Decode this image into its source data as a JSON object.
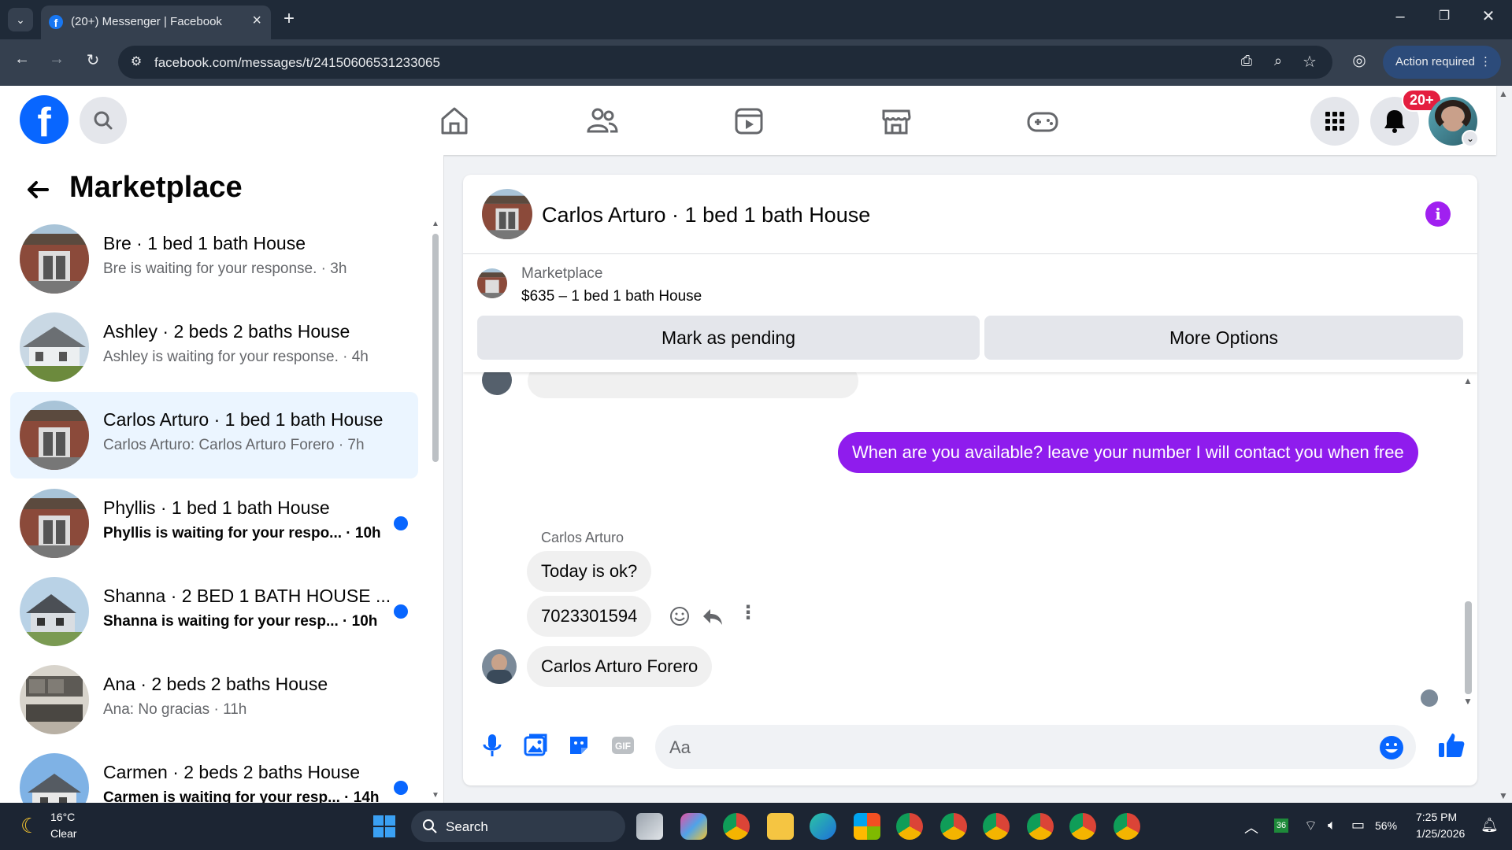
{
  "browser": {
    "tab_title": "(20+) Messenger | Facebook",
    "url": "facebook.com/messages/t/24150606531233065",
    "action_label": "Action required"
  },
  "header": {
    "notification_badge": "20+"
  },
  "sidebar": {
    "title": "Marketplace",
    "conversations": [
      {
        "name": "Bre · 1 bed 1 bath House",
        "preview": "Bre is waiting for your response. · 3h",
        "unread": false,
        "active": false
      },
      {
        "name": "Ashley · 2 beds 2 baths House",
        "preview": "Ashley is waiting for your response. · 4h",
        "unread": false,
        "active": false
      },
      {
        "name": "Carlos Arturo · 1 bed 1 bath House",
        "preview": "Carlos Arturo: Carlos Arturo Forero · 7h",
        "unread": false,
        "active": true
      },
      {
        "name": "Phyllis · 1 bed 1 bath House",
        "preview": "Phyllis is waiting for your respo... · 10h",
        "unread": true,
        "active": false
      },
      {
        "name": "Shanna · 2 BED 1 BATH HOUSE ...",
        "preview": "Shanna is waiting for your resp... · 10h",
        "unread": true,
        "active": false
      },
      {
        "name": "Ana · 2 beds 2 baths House",
        "preview": "Ana: No gracias · 11h",
        "unread": false,
        "active": false
      },
      {
        "name": "Carmen · 2 beds 2 baths House",
        "preview": "Carmen is waiting for your resp... · 14h",
        "unread": true,
        "active": false
      }
    ]
  },
  "chat": {
    "title": "Carlos Arturo · 1 bed 1 bath House",
    "marketplace_label": "Marketplace",
    "listing": "$635 – 1 bed 1 bath House",
    "mark_pending": "Mark as pending",
    "more_options": "More Options",
    "messages": {
      "outgoing": "When are you available? leave your number I will contact you when free",
      "sender": "Carlos Arturo",
      "in1": "Today is ok?",
      "in2": "7023301594",
      "in3": "Carlos Arturo Forero"
    },
    "input_placeholder": "Aa"
  },
  "taskbar": {
    "weather_temp": "16°C",
    "weather_desc": "Clear",
    "search_label": "Search",
    "badge_count": "36",
    "battery": "56%",
    "time": "7:25 PM",
    "date": "1/25/2026"
  },
  "colors": {
    "fb_blue": "#0866ff",
    "messenger_purple": "#8f1ced",
    "unread_dot": "#0866ff"
  }
}
